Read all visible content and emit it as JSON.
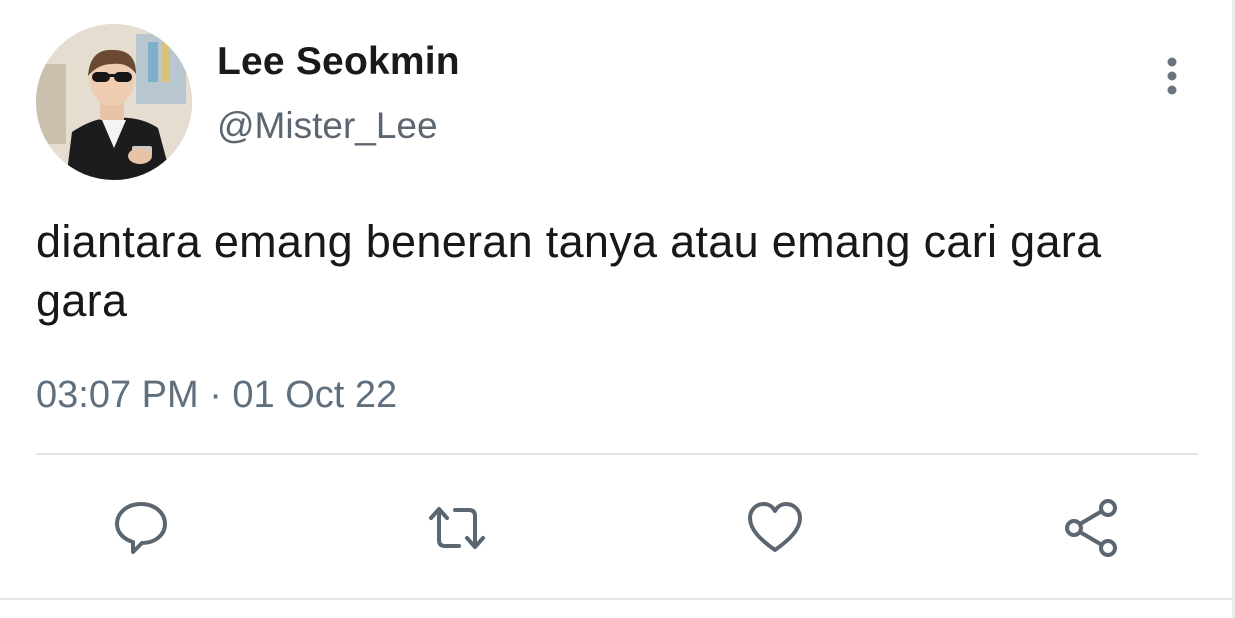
{
  "tweet": {
    "author": {
      "display_name": "Lee Seokmin",
      "handle": "@Mister_Lee"
    },
    "text": "diantara emang beneran tanya atau emang cari gara gara",
    "timestamp": "03:07 PM · 01 Oct 22"
  },
  "actions": [
    {
      "name": "reply",
      "icon": "reply-icon"
    },
    {
      "name": "retweet",
      "icon": "retweet-icon"
    },
    {
      "name": "like",
      "icon": "heart-icon"
    },
    {
      "name": "share",
      "icon": "share-icon"
    }
  ],
  "colors": {
    "text": "#16181a",
    "secondary": "#5b6670",
    "icon": "#5b6670",
    "divider": "#e3e6e8"
  }
}
